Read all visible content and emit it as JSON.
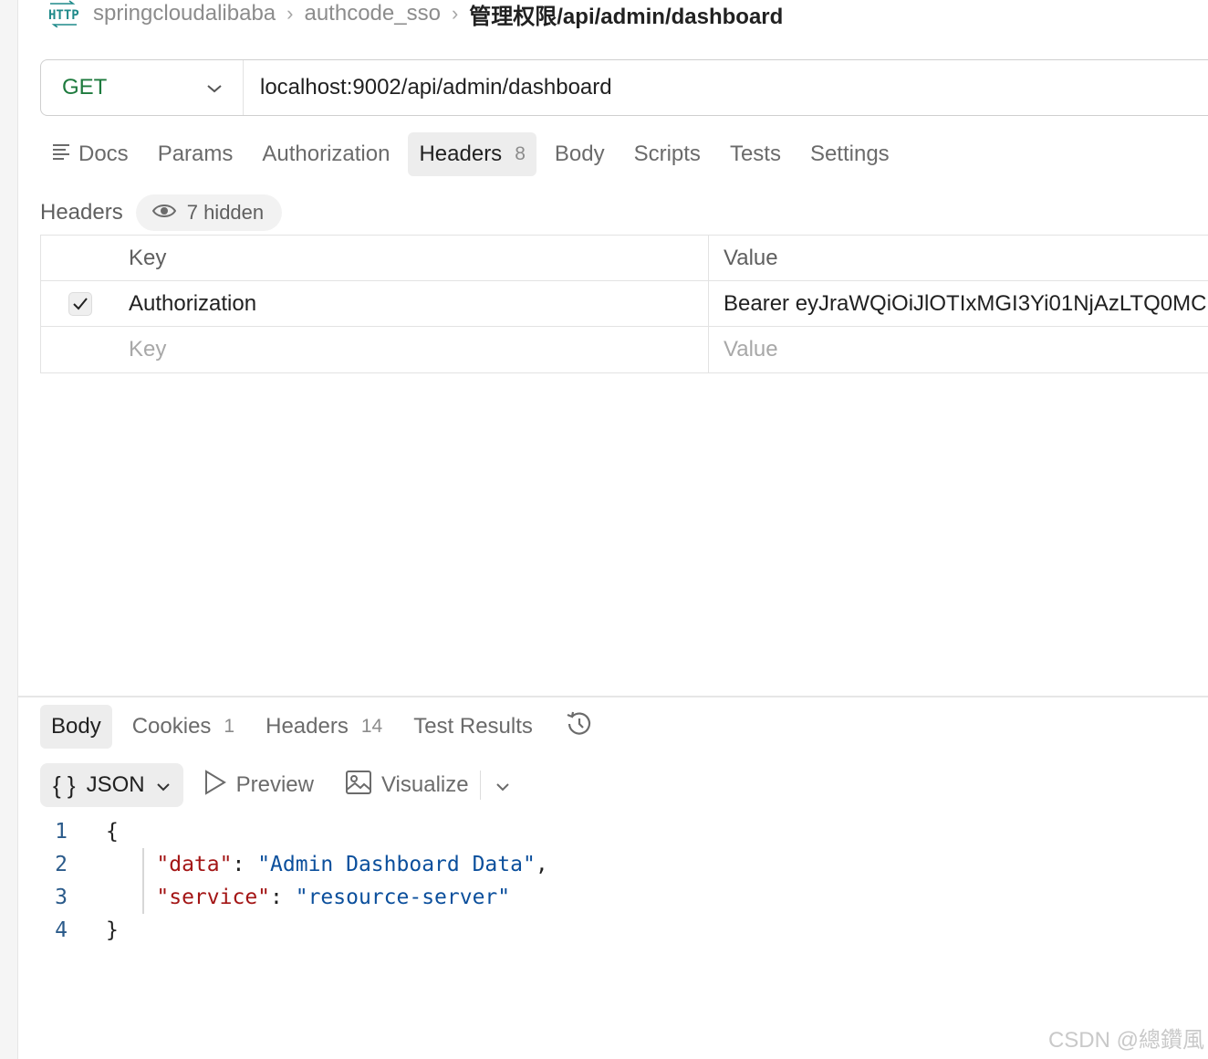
{
  "breadcrumb": {
    "icon": "http-request-icon",
    "workspace": "springcloudalibaba",
    "collection": "authcode_sso",
    "request": "管理权限/api/admin/dashboard"
  },
  "request": {
    "method": "GET",
    "method_color": "#1d7a3d",
    "url": "localhost:9002/api/admin/dashboard"
  },
  "request_tabs": {
    "docs": "Docs",
    "params": "Params",
    "authorization": "Authorization",
    "headers": "Headers",
    "headers_count": "8",
    "body": "Body",
    "scripts": "Scripts",
    "tests": "Tests",
    "settings": "Settings",
    "active": "Headers"
  },
  "headers": {
    "title": "Headers",
    "hidden_label": "7 hidden",
    "columns": {
      "key": "Key",
      "value": "Value"
    },
    "rows": [
      {
        "checked": true,
        "key": "Authorization",
        "value": "Bearer eyJraWQiOiJlOTIxMGI3Yi01NjAzLTQ0MC"
      }
    ],
    "new_row": {
      "key_placeholder": "Key",
      "value_placeholder": "Value"
    }
  },
  "response_tabs": {
    "body": "Body",
    "cookies": "Cookies",
    "cookies_count": "1",
    "headers": "Headers",
    "headers_count": "14",
    "test_results": "Test Results",
    "active": "Body"
  },
  "response_view": {
    "format": "JSON",
    "preview": "Preview",
    "visualize": "Visualize"
  },
  "response_body": {
    "lines": [
      {
        "n": "1",
        "brace_open": "{"
      },
      {
        "n": "2",
        "key": "\"data\"",
        "value": "\"Admin Dashboard Data\"",
        "trail": ","
      },
      {
        "n": "3",
        "key": "\"service\"",
        "value": "\"resource-server\"",
        "trail": ""
      },
      {
        "n": "4",
        "brace_close": "}"
      }
    ]
  },
  "watermark": "CSDN @總鑽風"
}
